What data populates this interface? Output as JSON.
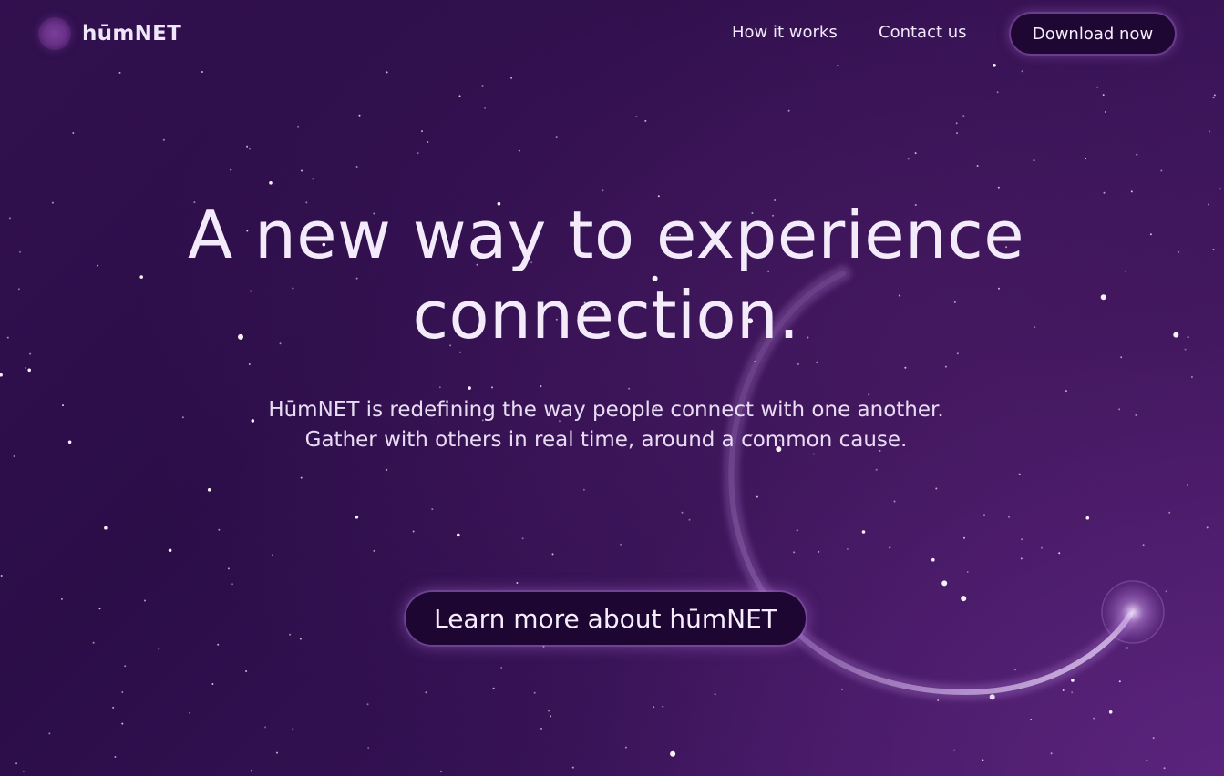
{
  "header": {
    "brand": "hūmNET",
    "nav": {
      "how_it_works": "How it works",
      "contact_us": "Contact us"
    },
    "download_label": "Download now"
  },
  "hero": {
    "headline_line1": "A new way to experience",
    "headline_line2": "connection.",
    "subtext_line1": "HūmNET is redefining the way people connect with one another.",
    "subtext_line2": "Gather with others in real time, around a common cause.",
    "cta_label": "Learn more about hūmNET"
  },
  "colors": {
    "background": "#2c0f49",
    "button_fill": "#1d0631",
    "text": "#f3ebfa",
    "glow": "#b478dc"
  },
  "icons": {
    "logo": "orb-logo-icon",
    "decoration": "glowing-orbit-arc"
  }
}
